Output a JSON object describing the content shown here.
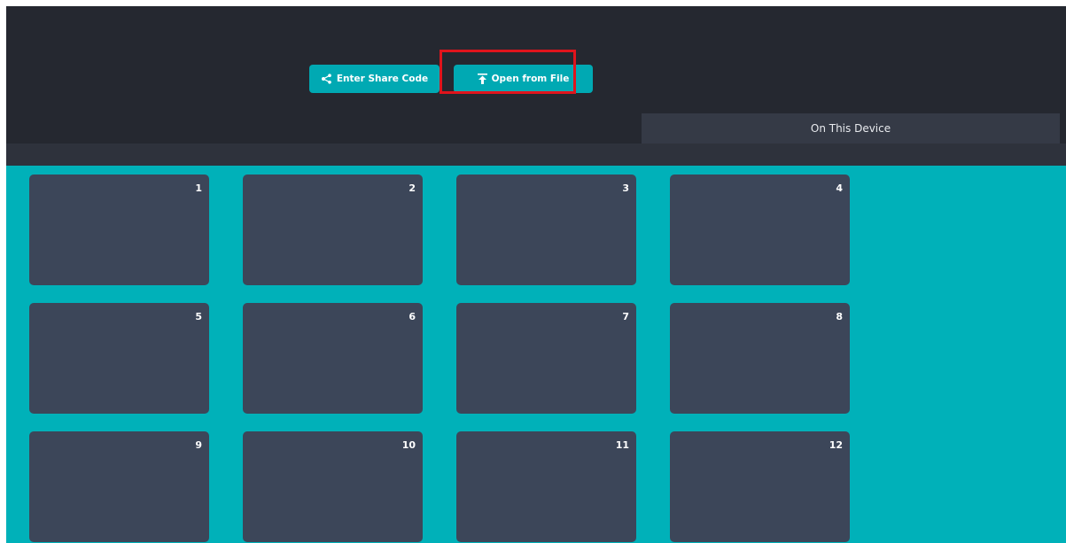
{
  "header": {
    "share_button": {
      "label": "Enter Share Code",
      "icon": "share-icon"
    },
    "file_button": {
      "label": "Open from File",
      "icon": "upload-icon"
    },
    "tab": {
      "label": "On This Device"
    }
  },
  "slots": [
    {
      "number": "1"
    },
    {
      "number": "2"
    },
    {
      "number": "3"
    },
    {
      "number": "4"
    },
    {
      "number": "5"
    },
    {
      "number": "6"
    },
    {
      "number": "7"
    },
    {
      "number": "8"
    },
    {
      "number": "9"
    },
    {
      "number": "10"
    },
    {
      "number": "11"
    },
    {
      "number": "12"
    }
  ],
  "colors": {
    "header_bg": "#252830",
    "accent": "#00b1b9",
    "slot_bg": "#3c4659",
    "highlight": "#e0141c"
  }
}
